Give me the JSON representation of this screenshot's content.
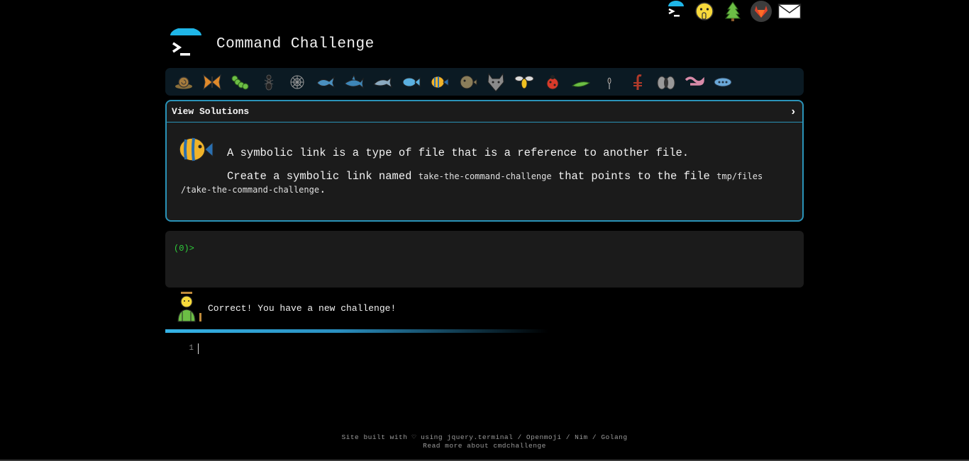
{
  "top_icons": [
    "terminal-icon",
    "shushing-face-icon",
    "tree-icon",
    "gitlab-icon",
    "mail-icon"
  ],
  "header": {
    "title": "Command Challenge"
  },
  "creatures": [
    "snail-icon",
    "butterfly-icon",
    "caterpillar-icon",
    "ant-icon",
    "spider-web-icon",
    "whale-icon",
    "shark-icon",
    "dolphin-icon",
    "fish-icon",
    "tropical-fish-icon",
    "blowfish-icon",
    "wolf-icon",
    "bee-icon",
    "ladybug-icon",
    "cricket-icon",
    "mosquito-icon",
    "scorpion-icon",
    "fly-icon",
    "worm-icon",
    "microbe-icon"
  ],
  "panel": {
    "toggle_label": "View Solutions",
    "toggle_chevron": "›",
    "line1": "A symbolic link is a type of file that is a reference to another file.",
    "line2_a": "Create a symbolic link named ",
    "line2_code1": "take-the-command-challenge",
    "line2_b": " that points to the file ",
    "line2_code2": "tmp/files /take-the-command-challenge",
    "line2_c": "."
  },
  "terminal": {
    "prompt": "(0)>"
  },
  "feedback": {
    "message": "Correct! You have a new challenge!"
  },
  "editor": {
    "line_number": "1"
  },
  "footer": {
    "line1_prefix": "Site built with ♡ using ",
    "link_jquery": "jquery.terminal",
    "sep1": " / ",
    "link_openmoji": "Openmoji",
    "sep2": " / ",
    "link_nim": "Nim",
    "sep3": " / ",
    "link_golang": "Golang",
    "link_readmore": "Read more about cmdchallenge"
  },
  "colors": {
    "accent": "#2a93b8",
    "prompt": "#2fd13b",
    "panel_bg": "#1b1b1b",
    "bar_bg": "#0b1a23"
  }
}
